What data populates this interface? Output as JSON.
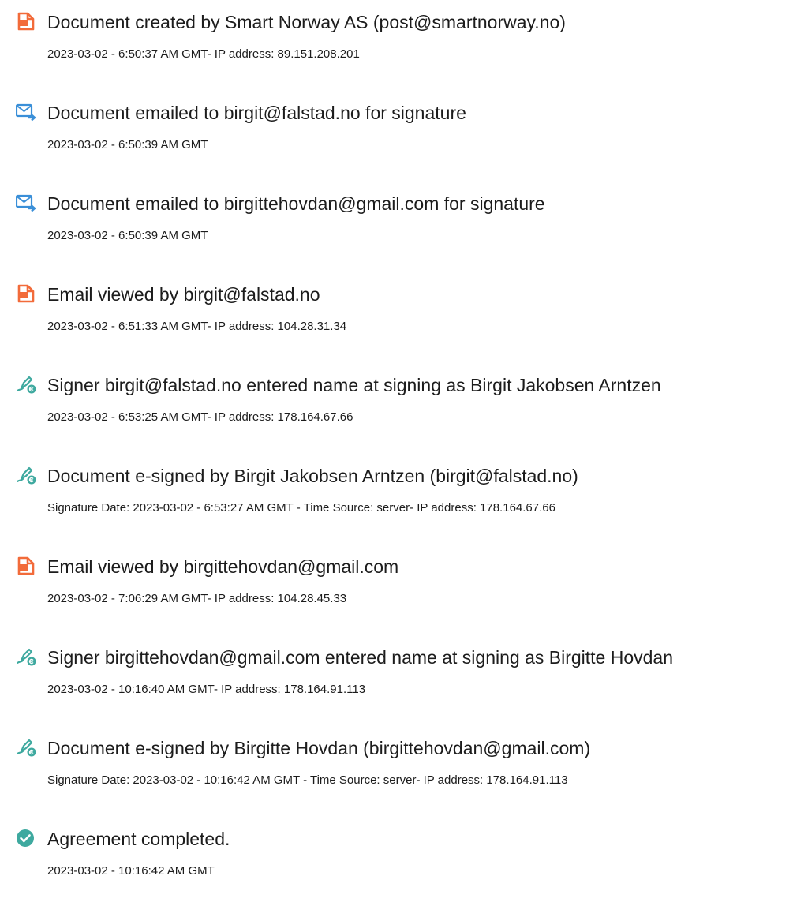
{
  "colors": {
    "doc_icon": "#f26b3a",
    "mail_icon": "#3a8fd8",
    "sign_icon": "#3ea99f",
    "check_icon": "#3ea99f",
    "text": "#1c1c1c"
  },
  "events": [
    {
      "icon": "document-icon",
      "title": "Document created by Smart Norway AS (post@smartnorway.no)",
      "detail": "2023-03-02 - 6:50:37 AM GMT- IP address: 89.151.208.201"
    },
    {
      "icon": "email-icon",
      "title": "Document emailed to birgit@falstad.no for signature",
      "detail": "2023-03-02 - 6:50:39 AM GMT"
    },
    {
      "icon": "email-icon",
      "title": "Document emailed to birgittehovdan@gmail.com for signature",
      "detail": "2023-03-02 - 6:50:39 AM GMT"
    },
    {
      "icon": "document-icon",
      "title": "Email viewed by birgit@falstad.no",
      "detail": "2023-03-02 - 6:51:33 AM GMT- IP address: 104.28.31.34"
    },
    {
      "icon": "signature-pen-icon",
      "title": "Signer birgit@falstad.no entered name at signing as Birgit Jakobsen Arntzen",
      "detail": "2023-03-02 - 6:53:25 AM GMT- IP address: 178.164.67.66"
    },
    {
      "icon": "signature-pen-icon",
      "title": "Document e-signed by Birgit Jakobsen Arntzen (birgit@falstad.no)",
      "detail": "Signature Date: 2023-03-02 - 6:53:27 AM GMT - Time Source: server- IP address: 178.164.67.66"
    },
    {
      "icon": "document-icon",
      "title": "Email viewed by birgittehovdan@gmail.com",
      "detail": "2023-03-02 - 7:06:29 AM GMT- IP address: 104.28.45.33"
    },
    {
      "icon": "signature-pen-icon",
      "title": "Signer birgittehovdan@gmail.com entered name at signing as Birgitte Hovdan",
      "detail": "2023-03-02 - 10:16:40 AM GMT- IP address: 178.164.91.113"
    },
    {
      "icon": "signature-pen-icon",
      "title": "Document e-signed by Birgitte Hovdan (birgittehovdan@gmail.com)",
      "detail": "Signature Date: 2023-03-02 - 10:16:42 AM GMT - Time Source: server- IP address: 178.164.91.113"
    },
    {
      "icon": "checkmark-circle-icon",
      "title": "Agreement completed.",
      "detail": "2023-03-02 - 10:16:42 AM GMT"
    }
  ]
}
